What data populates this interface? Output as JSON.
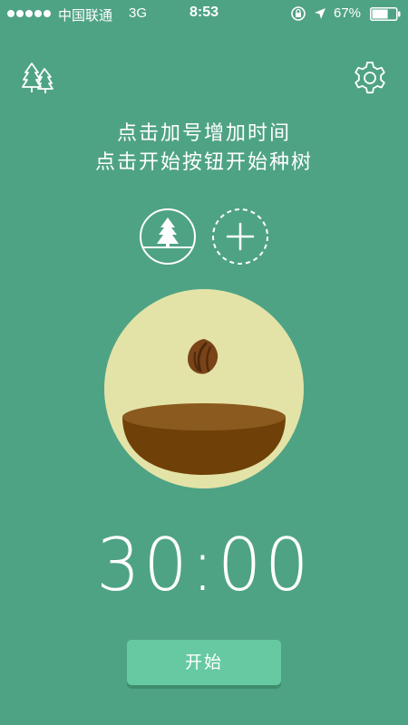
{
  "status_bar": {
    "carrier": "中国联通",
    "network": "3G",
    "time": "8:53",
    "battery_percent": "67%",
    "battery_level": 0.67,
    "icons": [
      "signal-dots",
      "orientation-lock-icon",
      "location-arrow-icon",
      "battery-icon"
    ]
  },
  "header": {
    "left_icon": "forest-icon",
    "right_icon": "gear-icon"
  },
  "instructions": {
    "line1": "点击加号增加时间",
    "line2": "点击开始按钮开始种树"
  },
  "controls": {
    "tree_button_icon": "tree-icon",
    "add_button_icon": "plus-icon"
  },
  "plant": {
    "icon": "seed-icon",
    "colors": {
      "circle": "#e4e3a7",
      "soil_top": "#8b5a1f",
      "soil_bowl": "#6f4108",
      "seed": "#7a4418"
    }
  },
  "timer": {
    "display": "30:00"
  },
  "start_button": {
    "label": "开始"
  },
  "colors": {
    "background": "#4fa385",
    "button": "#66c9a2",
    "text": "#ffffff"
  }
}
